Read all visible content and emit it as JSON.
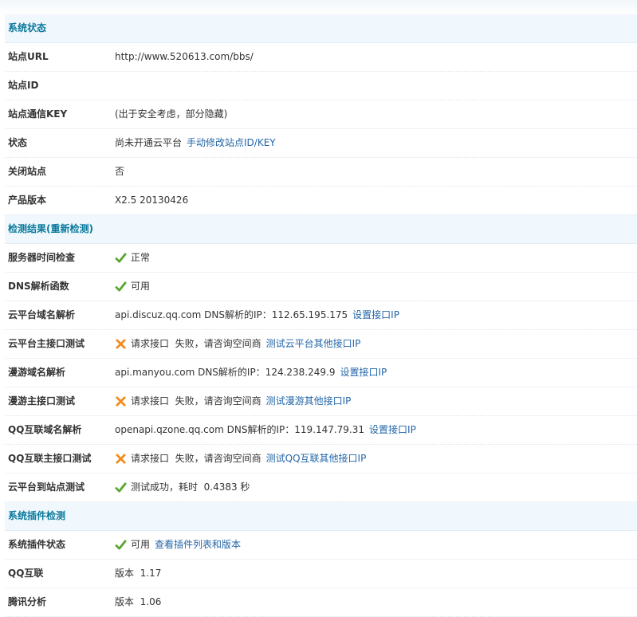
{
  "sections": {
    "system_status": "系统状态",
    "check_results": "检测结果(重新检测)",
    "plugin_check": "系统插件检测"
  },
  "site_url": {
    "label": "站点URL",
    "value": "http://www.520613.com/bbs/"
  },
  "site_id": {
    "label": "站点ID",
    "value": ""
  },
  "site_key": {
    "label": "站点通信KEY",
    "value": "(出于安全考虑，部分隐藏)"
  },
  "state": {
    "label": "状态",
    "value": "尚未开通云平台",
    "link": "手动修改站点ID/KEY"
  },
  "site_closed": {
    "label": "关闭站点",
    "value": "否"
  },
  "product_version": {
    "label": "产品版本",
    "value": "X2.5 20130426"
  },
  "server_time": {
    "label": "服务器时间检查",
    "value": "正常"
  },
  "dns_func": {
    "label": "DNS解析函数",
    "value": "可用"
  },
  "cloud_dns": {
    "label": "云平台域名解析",
    "value": "api.discuz.qq.com DNS解析的IP：112.65.195.175",
    "link": "设置接口IP"
  },
  "cloud_api": {
    "label": "云平台主接口测试",
    "value": "请求接口  失败，请咨询空间商",
    "link": "测试云平台其他接口IP"
  },
  "manyou_dns": {
    "label": "漫游域名解析",
    "value": "api.manyou.com DNS解析的IP：124.238.249.9",
    "link": "设置接口IP"
  },
  "manyou_api": {
    "label": "漫游主接口测试",
    "value": "请求接口  失败，请咨询空间商",
    "link": "测试漫游其他接口IP"
  },
  "qq_dns": {
    "label": "QQ互联域名解析",
    "value": "openapi.qzone.qq.com DNS解析的IP：119.147.79.31",
    "link": "设置接口IP"
  },
  "qq_api": {
    "label": "QQ互联主接口测试",
    "value": "请求接口  失败，请咨询空间商",
    "link": "测试QQ互联其他接口IP"
  },
  "cloud_to_site": {
    "label": "云平台到站点测试",
    "value": "测试成功，耗时  0.4383 秒"
  },
  "plugin_status": {
    "label": "系统插件状态",
    "value": "可用",
    "link": "查看插件列表和版本"
  },
  "qq_connect": {
    "label": "QQ互联",
    "value": "版本  1.17"
  },
  "tencent_analysis": {
    "label": "腾讯分析",
    "value": "版本  1.06"
  },
  "colors": {
    "section_title": "#0a7a9c",
    "section_bg": "#f0f7fd",
    "link": "#2366a8",
    "ok": "#5aa732",
    "fail": "#f08b1c"
  }
}
